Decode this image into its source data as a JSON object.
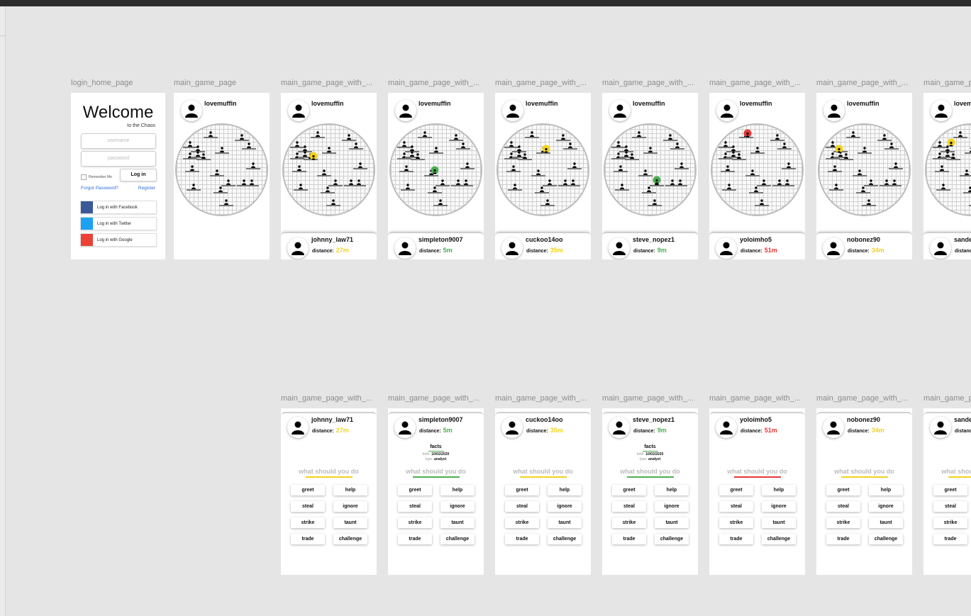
{
  "colors": {
    "yellow": "#f2d31b",
    "green": "#4caf50",
    "red": "#e53935",
    "facebook": "#3b5998",
    "twitter": "#1da1f2",
    "google": "#ea4335"
  },
  "login": {
    "label": "login_home_page",
    "title": "Welcome",
    "tagline": "to the Chaos",
    "username_placeholder": "username",
    "password_placeholder": "password",
    "remember": "Remember Me",
    "login_button": "Log in",
    "forgot": "Forgot Password?",
    "register": "Register",
    "social": [
      {
        "label": "Log in with Facebook",
        "color": "#3b5998"
      },
      {
        "label": "Log in with Twitter",
        "color": "#1da1f2"
      },
      {
        "label": "Log in with Google",
        "color": "#ea4335"
      }
    ]
  },
  "main": {
    "label": "main_game_page",
    "username": "lovemuffin"
  },
  "game_frames": [
    {
      "label": "main_game_page_with_...",
      "username": "lovemuffin",
      "player": "johnny_law71",
      "distance_label": "distance:",
      "distance": "27m",
      "color": "#f2d31b"
    },
    {
      "label": "main_game_page_with_...",
      "username": "lovemuffin",
      "player": "simpleton9007",
      "distance_label": "distance:",
      "distance": "5m",
      "color": "#4caf50"
    },
    {
      "label": "main_game_page_with_...",
      "username": "lovemuffin",
      "player": "cuckoo14oo",
      "distance_label": "distance:",
      "distance": "35m",
      "color": "#f2d31b"
    },
    {
      "label": "main_game_page_with_...",
      "username": "lovemuffin",
      "player": "steve_nopez1",
      "distance_label": "distance:",
      "distance": "9m",
      "color": "#4caf50"
    },
    {
      "label": "main_game_page_with_...",
      "username": "lovemuffin",
      "player": "yoloimho5",
      "distance_label": "distance:",
      "distance": "51m",
      "color": "#e53935"
    },
    {
      "label": "main_game_page_with_...",
      "username": "lovemuffin",
      "player": "nobonez90",
      "distance_label": "distance:",
      "distance": "34m",
      "color": "#f2d31b"
    },
    {
      "label": "main_game_p",
      "username": "lovem",
      "player": "sande",
      "distance_label": "distanc",
      "distance": "",
      "color": "#f2d31b"
    }
  ],
  "detail_frames": [
    {
      "label": "main_game_page_with_...",
      "player": "johnny_law71",
      "distance_label": "distance:",
      "distance": "27m",
      "color": "#f2d31b",
      "facts": null
    },
    {
      "label": "main_game_page_with_...",
      "player": "simpleton9007",
      "distance_label": "distance:",
      "distance": "5m",
      "color": "#4caf50",
      "facts": {
        "title": "facts",
        "birth_label": "birth:",
        "birth": "10/02/2020",
        "type_label": "type:",
        "type": "analyst"
      }
    },
    {
      "label": "main_game_page_with_...",
      "player": "cuckoo14oo",
      "distance_label": "distance:",
      "distance": "35m",
      "color": "#f2d31b",
      "facts": null
    },
    {
      "label": "main_game_page_with_...",
      "player": "steve_nopez1",
      "distance_label": "distance:",
      "distance": "9m",
      "color": "#4caf50",
      "facts": {
        "title": "facts",
        "birth_label": "birth:",
        "birth": "10/02/2020",
        "type_label": "type:",
        "type": "analyst"
      }
    },
    {
      "label": "main_game_page_with_...",
      "player": "yoloimho5",
      "distance_label": "distance:",
      "distance": "51m",
      "color": "#e53935",
      "facts": null
    },
    {
      "label": "main_game_page_with_...",
      "player": "nobonez90",
      "distance_label": "distance:",
      "distance": "34m",
      "color": "#f2d31b",
      "facts": null
    },
    {
      "label": "main_game_page_",
      "player": "sande",
      "distance_label": "distanc",
      "distance": "",
      "color": "#f2d31b",
      "facts": null
    }
  ],
  "actions": {
    "prompt": "what should you do",
    "buttons": [
      "greet",
      "help",
      "steal",
      "ignore",
      "strike",
      "taunt",
      "trade",
      "challenge"
    ]
  }
}
